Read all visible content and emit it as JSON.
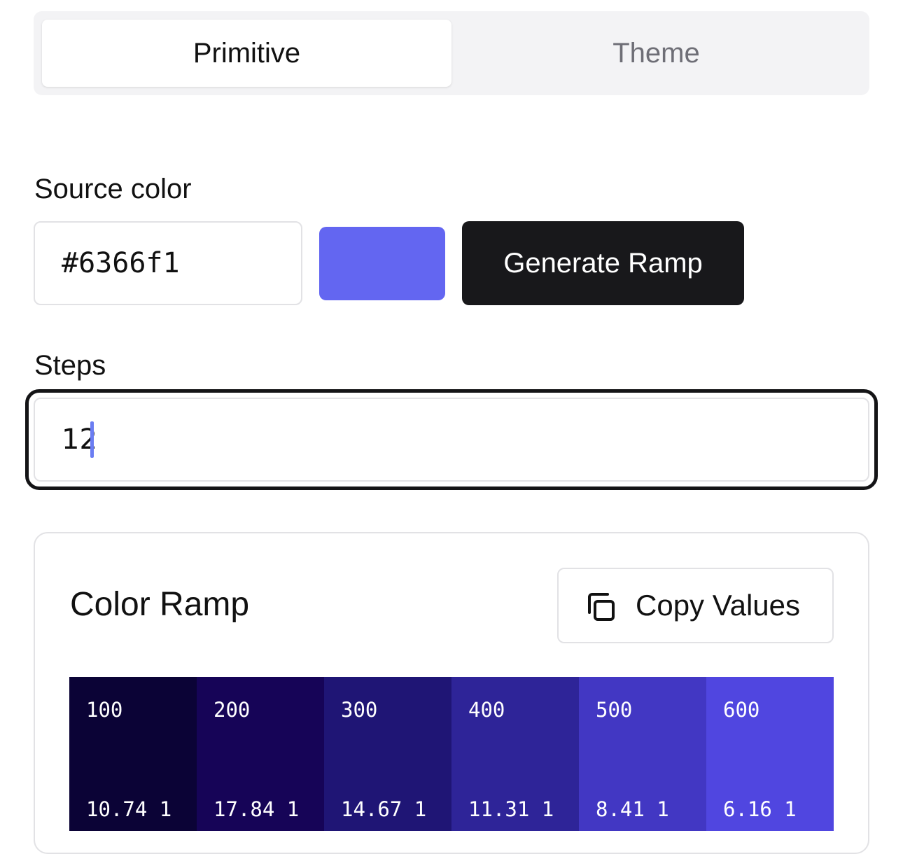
{
  "tabs": [
    {
      "label": "Primitive",
      "active": true
    },
    {
      "label": "Theme",
      "active": false
    }
  ],
  "source": {
    "label": "Source color",
    "value": "#6366f1",
    "swatch_color": "#6366f1",
    "generate_label": "Generate Ramp"
  },
  "steps": {
    "label": "Steps",
    "value": "12"
  },
  "ramp": {
    "title": "Color Ramp",
    "copy_label": "Copy Values",
    "copy_icon": "copy-icon",
    "cells": [
      {
        "step": "100",
        "value": "10.74 1",
        "color": "#0b0336"
      },
      {
        "step": "200",
        "value": "17.84 1",
        "color": "#160457"
      },
      {
        "step": "300",
        "value": "14.67 1",
        "color": "#1f1575"
      },
      {
        "step": "400",
        "value": "11.31 1",
        "color": "#2e2498"
      },
      {
        "step": "500",
        "value": "8.41 1",
        "color": "#4237c3"
      },
      {
        "step": "600",
        "value": "6.16 1",
        "color": "#5046e0"
      }
    ]
  }
}
